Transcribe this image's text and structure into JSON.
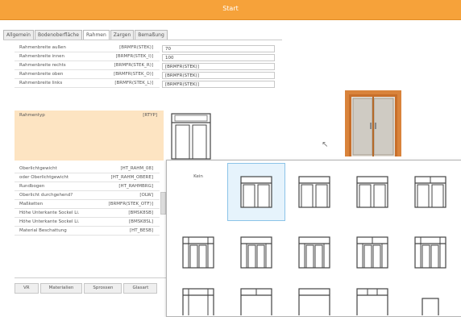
{
  "window": {
    "title": "Start",
    "accent": "#f6a23a"
  },
  "tabs": [
    {
      "label": "Allgemein",
      "active": false
    },
    {
      "label": "Bodenoberfläche",
      "active": false
    },
    {
      "label": "Rahmen",
      "active": true
    },
    {
      "label": "Zargen",
      "active": false
    },
    {
      "label": "Bemaßung",
      "active": false
    }
  ],
  "properties": [
    {
      "label": "Rahmenbreite außen",
      "code": "[BRMFR(STEK)]",
      "value": "70"
    },
    {
      "label": "Rahmenbreite innen",
      "code": "[BRMFR(STEK_I)]",
      "value": "100"
    },
    {
      "label": "Rahmenbreite rechts",
      "code": "[BRMFR(STEK_R)]",
      "value": "[BRMFR(STEK)]"
    },
    {
      "label": "Rahmenbreite oben",
      "code": "[BRMFR(STEK_O)]",
      "value": "[BRMFR(STEK)]"
    },
    {
      "label": "Rahmenbreite links",
      "code": "[BRMFR(STEK_L)]",
      "value": "[BRMFR(STEK)]"
    }
  ],
  "rahmentyp": {
    "label": "Rahmentyp",
    "code": "[RTYP]"
  },
  "properties2": [
    {
      "label": "Oberlichtgewicht",
      "code": "[HT_RAHM_08]"
    },
    {
      "label": "oder Oberlichtgewicht",
      "code": "[HT_RAHM_OBERE]"
    },
    {
      "label": "Rundbogen",
      "code": "[HT_RAHMBRG]"
    },
    {
      "label": "Oberlicht durchgehend?",
      "code": "[OLW]"
    },
    {
      "label": "Maßketten",
      "code": "[BRMFR(STEK_OTF)]"
    },
    {
      "label": "Höhe Unterkante Sockel Li.",
      "code": "[BMSK8SB]"
    },
    {
      "label": "Höhe Unterkante Sockel Li.",
      "code": "[BMSK8SL]"
    },
    {
      "label": "Material Beschattung",
      "code": "[HT_BESB]"
    }
  ],
  "bottom_tabs": [
    {
      "label": "VR"
    },
    {
      "label": "Materialien"
    },
    {
      "label": "Sprossen"
    },
    {
      "label": "Glasart"
    }
  ],
  "popup": {
    "none_label": "Kein"
  }
}
